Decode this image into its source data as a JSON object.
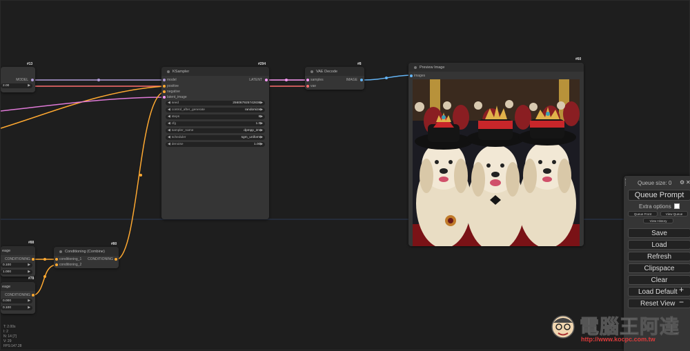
{
  "nodes": {
    "left_top": {
      "id": "#13",
      "output_label": "MODEL",
      "value": "2.00"
    },
    "ksampler": {
      "id": "#294",
      "title": "KSampler",
      "inputs": [
        "model",
        "positive",
        "negative",
        "latent_image"
      ],
      "output_label": "LATENT",
      "widgets": [
        {
          "label": "seed",
          "value": "256067925742836"
        },
        {
          "label": "control_after_generate",
          "value": "randomize"
        },
        {
          "label": "steps",
          "value": "6"
        },
        {
          "label": "cfg",
          "value": "1.0"
        },
        {
          "label": "sampler_name",
          "value": "dpmpp_2m"
        },
        {
          "label": "scheduler",
          "value": "sgm_uniform"
        },
        {
          "label": "denoise",
          "value": "1.00"
        }
      ]
    },
    "vae_decode": {
      "id": "#8",
      "title": "VAE Decode",
      "inputs": [
        "samples",
        "vae"
      ],
      "output_label": "IMAGE"
    },
    "preview": {
      "id": "#60",
      "title": "Preview Image",
      "input": "images"
    },
    "cond_combine": {
      "id": "#80",
      "title": "Conditioning (Combine)",
      "inputs": [
        "conditioning_1",
        "conditioning_2"
      ],
      "output_label": "CONDITIONING"
    },
    "left_mid": {
      "id": "#88",
      "title": "eage",
      "output_label": "CONDITIONING",
      "values": [
        "0.100",
        "1.000"
      ]
    },
    "left_bot": {
      "id": "#78",
      "title": "eage",
      "output_label": "CONDITIONING",
      "values": [
        "0.000",
        "0.100"
      ]
    }
  },
  "queue": {
    "size_label": "Queue size: 0",
    "queue_prompt": "Queue Prompt",
    "extra_options": "Extra options",
    "queue_front": "Queue Front",
    "view_queue": "View Queue",
    "view_history": "View History",
    "buttons": [
      "Save",
      "Load",
      "Refresh",
      "Clipspace",
      "Clear",
      "Load Default",
      "Reset View"
    ],
    "zoom_in": "+",
    "zoom_out": "−"
  },
  "stats": [
    "T: 2.00s",
    "I: 2",
    "N: 14 [7]",
    "V: 29",
    "FPS:147.28"
  ],
  "watermark": {
    "text": "電腦王阿達",
    "url": "http://www.kocpc.com.tw"
  },
  "colors": {
    "canvas": "#1e1e1e",
    "node": "#353535",
    "wire_model": "#b39ddb",
    "wire_conditioning": "#ffa931",
    "wire_latent": "#ff9cf9",
    "wire_vae": "#ff6e6e",
    "wire_image": "#64b5f6",
    "wire_pink": "#e07ad8"
  }
}
